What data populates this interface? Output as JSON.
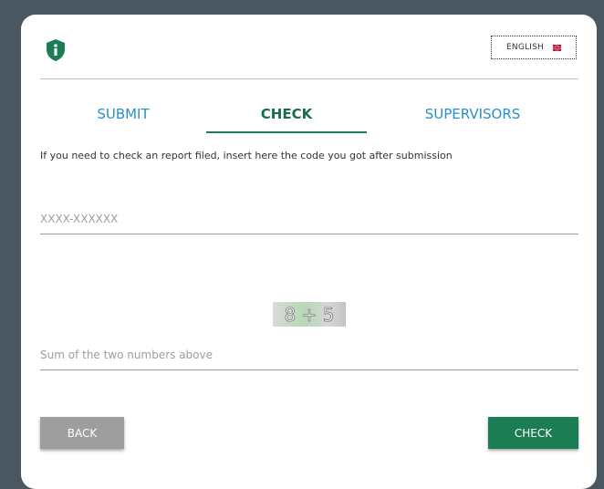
{
  "header": {
    "language_label": "ENGLISH",
    "icons": {
      "logo": "shield-info-icon",
      "flag": "uk-flag-icon"
    }
  },
  "tabs": [
    {
      "label": "SUBMIT",
      "active": false
    },
    {
      "label": "CHECK",
      "active": true
    },
    {
      "label": "SUPERVISORS",
      "active": false
    }
  ],
  "form": {
    "hint": "If you need to check an report filed, insert here the code you got after submission",
    "code_placeholder": "XXXX-XXXXXX",
    "code_value": "",
    "captcha_text": "8 + 5",
    "sum_placeholder": "Sum of the two numbers above",
    "sum_value": ""
  },
  "buttons": {
    "back": "BACK",
    "check": "CHECK"
  },
  "colors": {
    "background": "#4a5760",
    "primary_green": "#1c7c54",
    "tab_blue": "#2b8fc6",
    "back_gray": "#9e9e9e"
  }
}
